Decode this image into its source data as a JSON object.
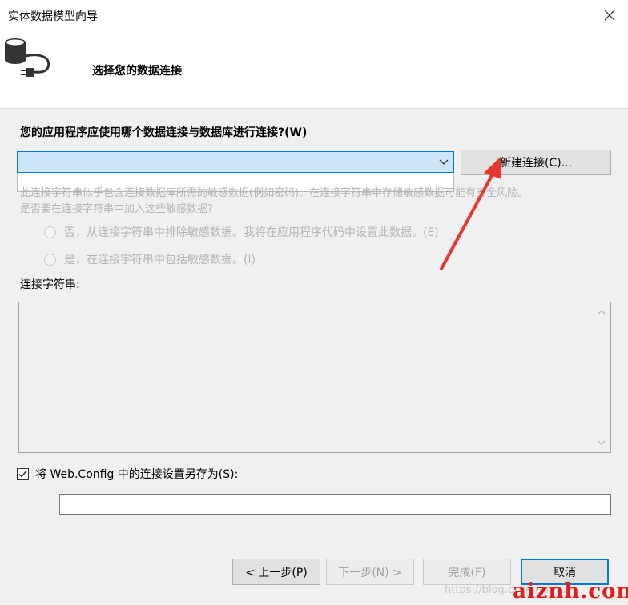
{
  "window": {
    "title": "实体数据模型向导"
  },
  "header": {
    "title": "选择您的数据连接"
  },
  "connection": {
    "question": "您的应用程序应使用哪个数据连接与数据库进行连接?(W)",
    "selected_value": "",
    "new_connection_label": "新建连接(C)..."
  },
  "sensitive": {
    "warning_line1": "此连接字符串似乎包含连接数据库所需的敏感数据(例如密码)。在连接字符串中存储敏感数据可能有安全风险。",
    "warning_line2": "是否要在连接字符串中加入这些敏感数据?",
    "option_exclude": "否，从连接字符串中排除敏感数据。我将在应用程序代码中设置此数据。(E)",
    "option_include": "是，在连接字符串中包括敏感数据。(I)"
  },
  "connection_string": {
    "label": "连接字符串:",
    "value": ""
  },
  "save": {
    "checked": true,
    "label": "将 Web.Config 中的连接设置另存为(S):",
    "value": ""
  },
  "buttons": {
    "previous": "< 上一步(P)",
    "next": "下一步(N) >",
    "finish": "完成(F)",
    "cancel": "取消"
  },
  "watermark": {
    "faint": "https://blog.csdn.net/...",
    "brand": "aiznh.com"
  },
  "colors": {
    "accent": "#0078d7",
    "combo_bg": "#cce4f7",
    "annotation_arrow": "#e8372e",
    "watermark": "#e21b1b"
  }
}
